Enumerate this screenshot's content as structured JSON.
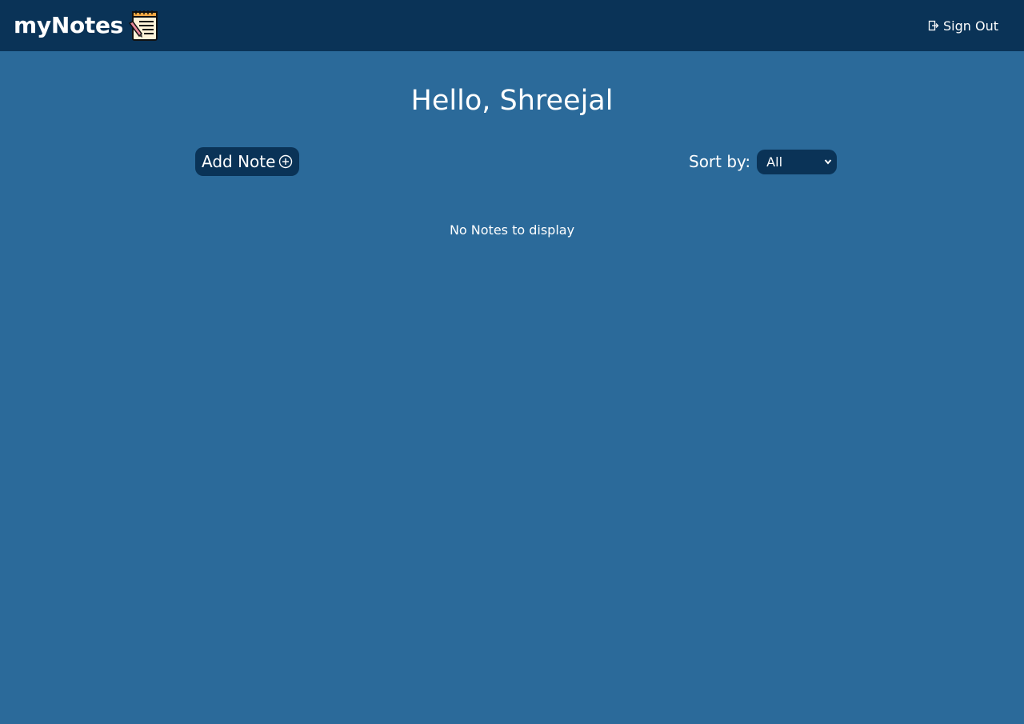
{
  "header": {
    "brand": "myNotes",
    "sign_out_label": "Sign Out"
  },
  "main": {
    "greeting": "Hello, Shreejal",
    "add_note_label": "Add Note",
    "sort_label": "Sort by:",
    "sort_selected": "All",
    "empty_message": "No Notes to display"
  },
  "icons": {
    "logo": "notepad-pencil-icon",
    "sign_out": "sign-out-icon",
    "add": "plus-circle-icon",
    "dropdown": "chevron-down-icon"
  },
  "colors": {
    "background": "#2b6a9a",
    "navbar": "#0a3357",
    "text": "#ffffff"
  }
}
